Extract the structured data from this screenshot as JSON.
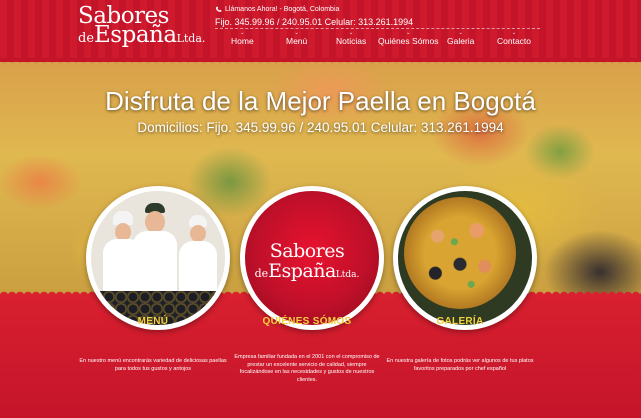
{
  "logo": {
    "line1": "Sabores",
    "line2_prefix": "de",
    "line2_main": "España",
    "line2_suffix": "Ltda."
  },
  "header": {
    "call_text": "Llámanos Ahora! - Bogotá, Colombia",
    "phones": "Fijo. 345.99.96 / 240.95.01 Celular: 313.261.1994",
    "nav": [
      {
        "label": "Home"
      },
      {
        "label": "Menú"
      },
      {
        "label": "Noticias"
      },
      {
        "label": "Quiénes Sómos"
      },
      {
        "label": "Galeria"
      },
      {
        "label": "Contacto"
      }
    ],
    "chevron": "⌄"
  },
  "hero": {
    "title": "Disfruta de la Mejor Paella en Bogotá",
    "subtitle": "Domicilios: Fijo. 345.99.96 / 240.95.01 Celular: 313.261.1994"
  },
  "sections": [
    {
      "title": "MENÚ",
      "text": "En nuestro menú encontrarás variedad de deliciosas paellas para todos tus gustos y antojos"
    },
    {
      "title": "QUIÉNES SÓMOS",
      "text": "Empresa familiar fundada en el 2001 con el compromiso de prestar un excelente servicio de calidad, siempre focalizándose en las necesidades y gustos de nuestros clientes."
    },
    {
      "title": "GALERÍA",
      "text": "En nuestra galería de fotos podrás ver algunos de tus platos favoritos preparados por chef español"
    }
  ],
  "icons": {
    "phone": "phone-icon"
  },
  "colors": {
    "brand_red": "#c8102e",
    "accent_yellow": "#f3d03e"
  }
}
